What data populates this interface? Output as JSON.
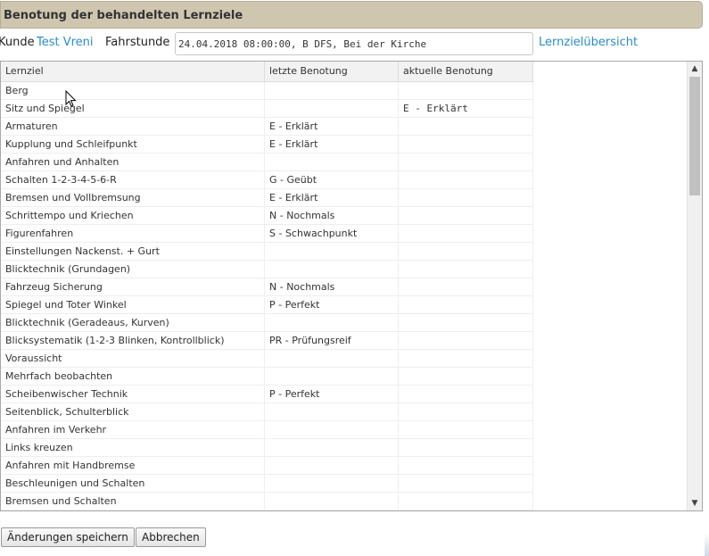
{
  "dialog": {
    "title": "Benotung der behandelten Lernziele"
  },
  "customer": {
    "kunde_label": "Kunde",
    "kunde_name": "Test Vreni",
    "fahrstunde_label": "Fahrstunde",
    "fahrstunde_value": "24.04.2018 08:00:00, B DFS, Bei der Kirche",
    "overview_link": "Lernzielübersicht"
  },
  "grid": {
    "columns": [
      "Lernziel",
      "letzte Benotung",
      "aktuelle Benotung"
    ],
    "rows": [
      [
        "Berg",
        "",
        ""
      ],
      [
        "Sitz und Spiegel",
        "",
        "E - Erklärt"
      ],
      [
        "Armaturen",
        "E - Erklärt",
        ""
      ],
      [
        "Kupplung und Schleifpunkt",
        "E - Erklärt",
        ""
      ],
      [
        "Anfahren und Anhalten",
        "",
        ""
      ],
      [
        "Schalten 1-2-3-4-5-6-R",
        "G - Geübt",
        ""
      ],
      [
        "Bremsen und Vollbremsung",
        "E - Erklärt",
        ""
      ],
      [
        "Schrittempo und Kriechen",
        "N - Nochmals",
        ""
      ],
      [
        "Figurenfahren",
        "S - Schwachpunkt",
        ""
      ],
      [
        "Einstellungen Nackenst. + Gurt",
        "",
        ""
      ],
      [
        "Blicktechnik (Grundagen)",
        "",
        ""
      ],
      [
        "Fahrzeug Sicherung",
        "N - Nochmals",
        ""
      ],
      [
        "Spiegel und Toter Winkel",
        "P - Perfekt",
        ""
      ],
      [
        "Blicktechnik (Geradeaus, Kurven)",
        "",
        ""
      ],
      [
        "Blicksystematik (1-2-3 Blinken, Kontrollblick)",
        "PR - Prüfungsreif",
        ""
      ],
      [
        "Voraussicht",
        "",
        ""
      ],
      [
        "Mehrfach beobachten",
        "",
        ""
      ],
      [
        "Scheibenwischer Technik",
        "P - Perfekt",
        ""
      ],
      [
        "Seitenblick, Schulterblick",
        "",
        ""
      ],
      [
        "Anfahren im Verkehr",
        "",
        ""
      ],
      [
        "Links kreuzen",
        "",
        ""
      ],
      [
        "Anfahren mit Handbremse",
        "",
        ""
      ],
      [
        "Beschleunigen und Schalten",
        "",
        ""
      ],
      [
        "Bremsen und Schalten",
        "",
        ""
      ]
    ]
  },
  "buttons": {
    "save": "Änderungen speichern",
    "cancel": "Abbrechen"
  },
  "icons": {
    "scroll_up": "scroll-up-arrow-icon",
    "scroll_down": "scroll-down-arrow-icon",
    "pointer": "mouse-pointer-icon"
  },
  "colors": {
    "titlebar": "#cfc6b0",
    "link": "#2a8bd0"
  }
}
